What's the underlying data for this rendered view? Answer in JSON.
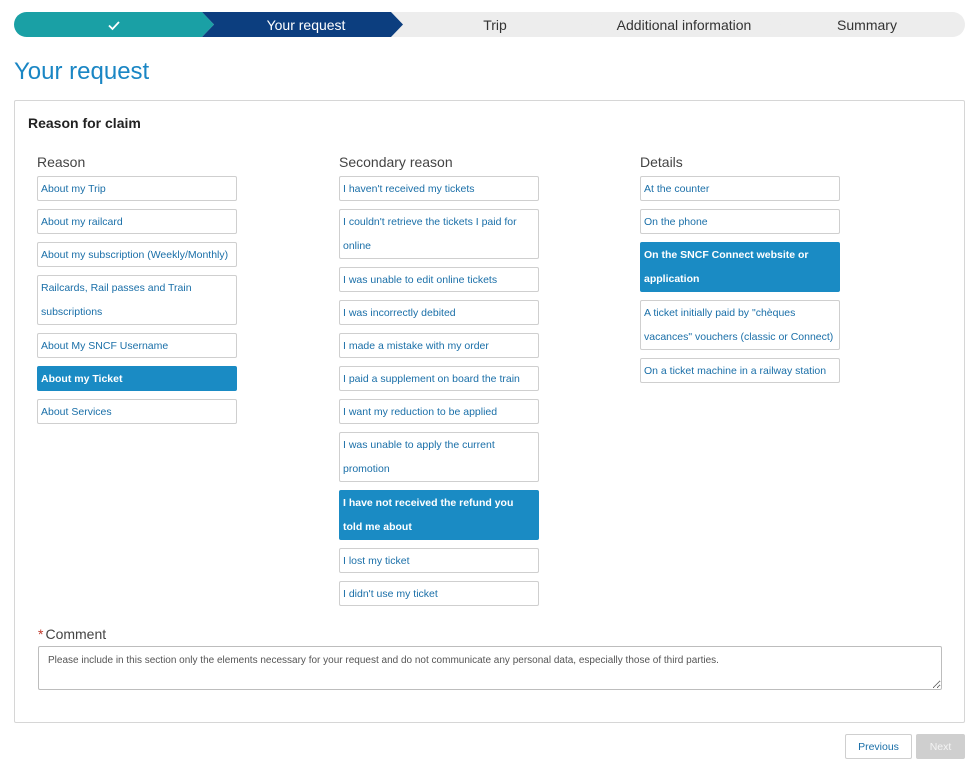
{
  "stepper": {
    "steps": [
      {
        "label": "",
        "state": "done"
      },
      {
        "label": "Your request",
        "state": "active"
      },
      {
        "label": "Trip",
        "state": "upcoming"
      },
      {
        "label": "Additional information",
        "state": "upcoming"
      },
      {
        "label": "Summary",
        "state": "upcoming"
      }
    ]
  },
  "page": {
    "title": "Your request"
  },
  "claim": {
    "title": "Reason for claim",
    "reason": {
      "label": "Reason",
      "options": [
        "About my Trip",
        "About my railcard",
        "About my subscription (Weekly/Monthly)",
        "Railcards, Rail passes and Train subscriptions",
        "About My SNCF Username",
        "About my Ticket",
        "About Services"
      ]
    },
    "secondary": {
      "label": "Secondary reason",
      "options": [
        "I haven't received my tickets",
        "I couldn't retrieve the tickets I paid for online",
        "I was unable to edit online tickets",
        "I was incorrectly debited",
        "I made a mistake with my order",
        "I paid a supplement on board the train",
        "I want my reduction to be applied",
        "I was unable to apply the current promotion",
        "I have not received the refund you told me about",
        "I lost my ticket",
        "I didn't use my ticket"
      ]
    },
    "details": {
      "label": "Details",
      "options": [
        "At the counter",
        "On the phone",
        "On the SNCF Connect website or application",
        "A ticket initially paid by \"chèques vacances\" vouchers (classic or Connect)",
        "On a ticket machine in a railway station"
      ]
    }
  },
  "comment": {
    "required_mark": "*",
    "label": "Comment",
    "placeholder": "Please include in this section only the elements necessary for your request and do not communicate any personal data, especially those of third parties."
  },
  "footer": {
    "previous_label": "Previous",
    "next_label": "Next"
  },
  "colors": {
    "done": "#1aa0a5",
    "active": "#0c3e7f",
    "selected": "#1a8bc4",
    "link": "#1a6fa8"
  }
}
